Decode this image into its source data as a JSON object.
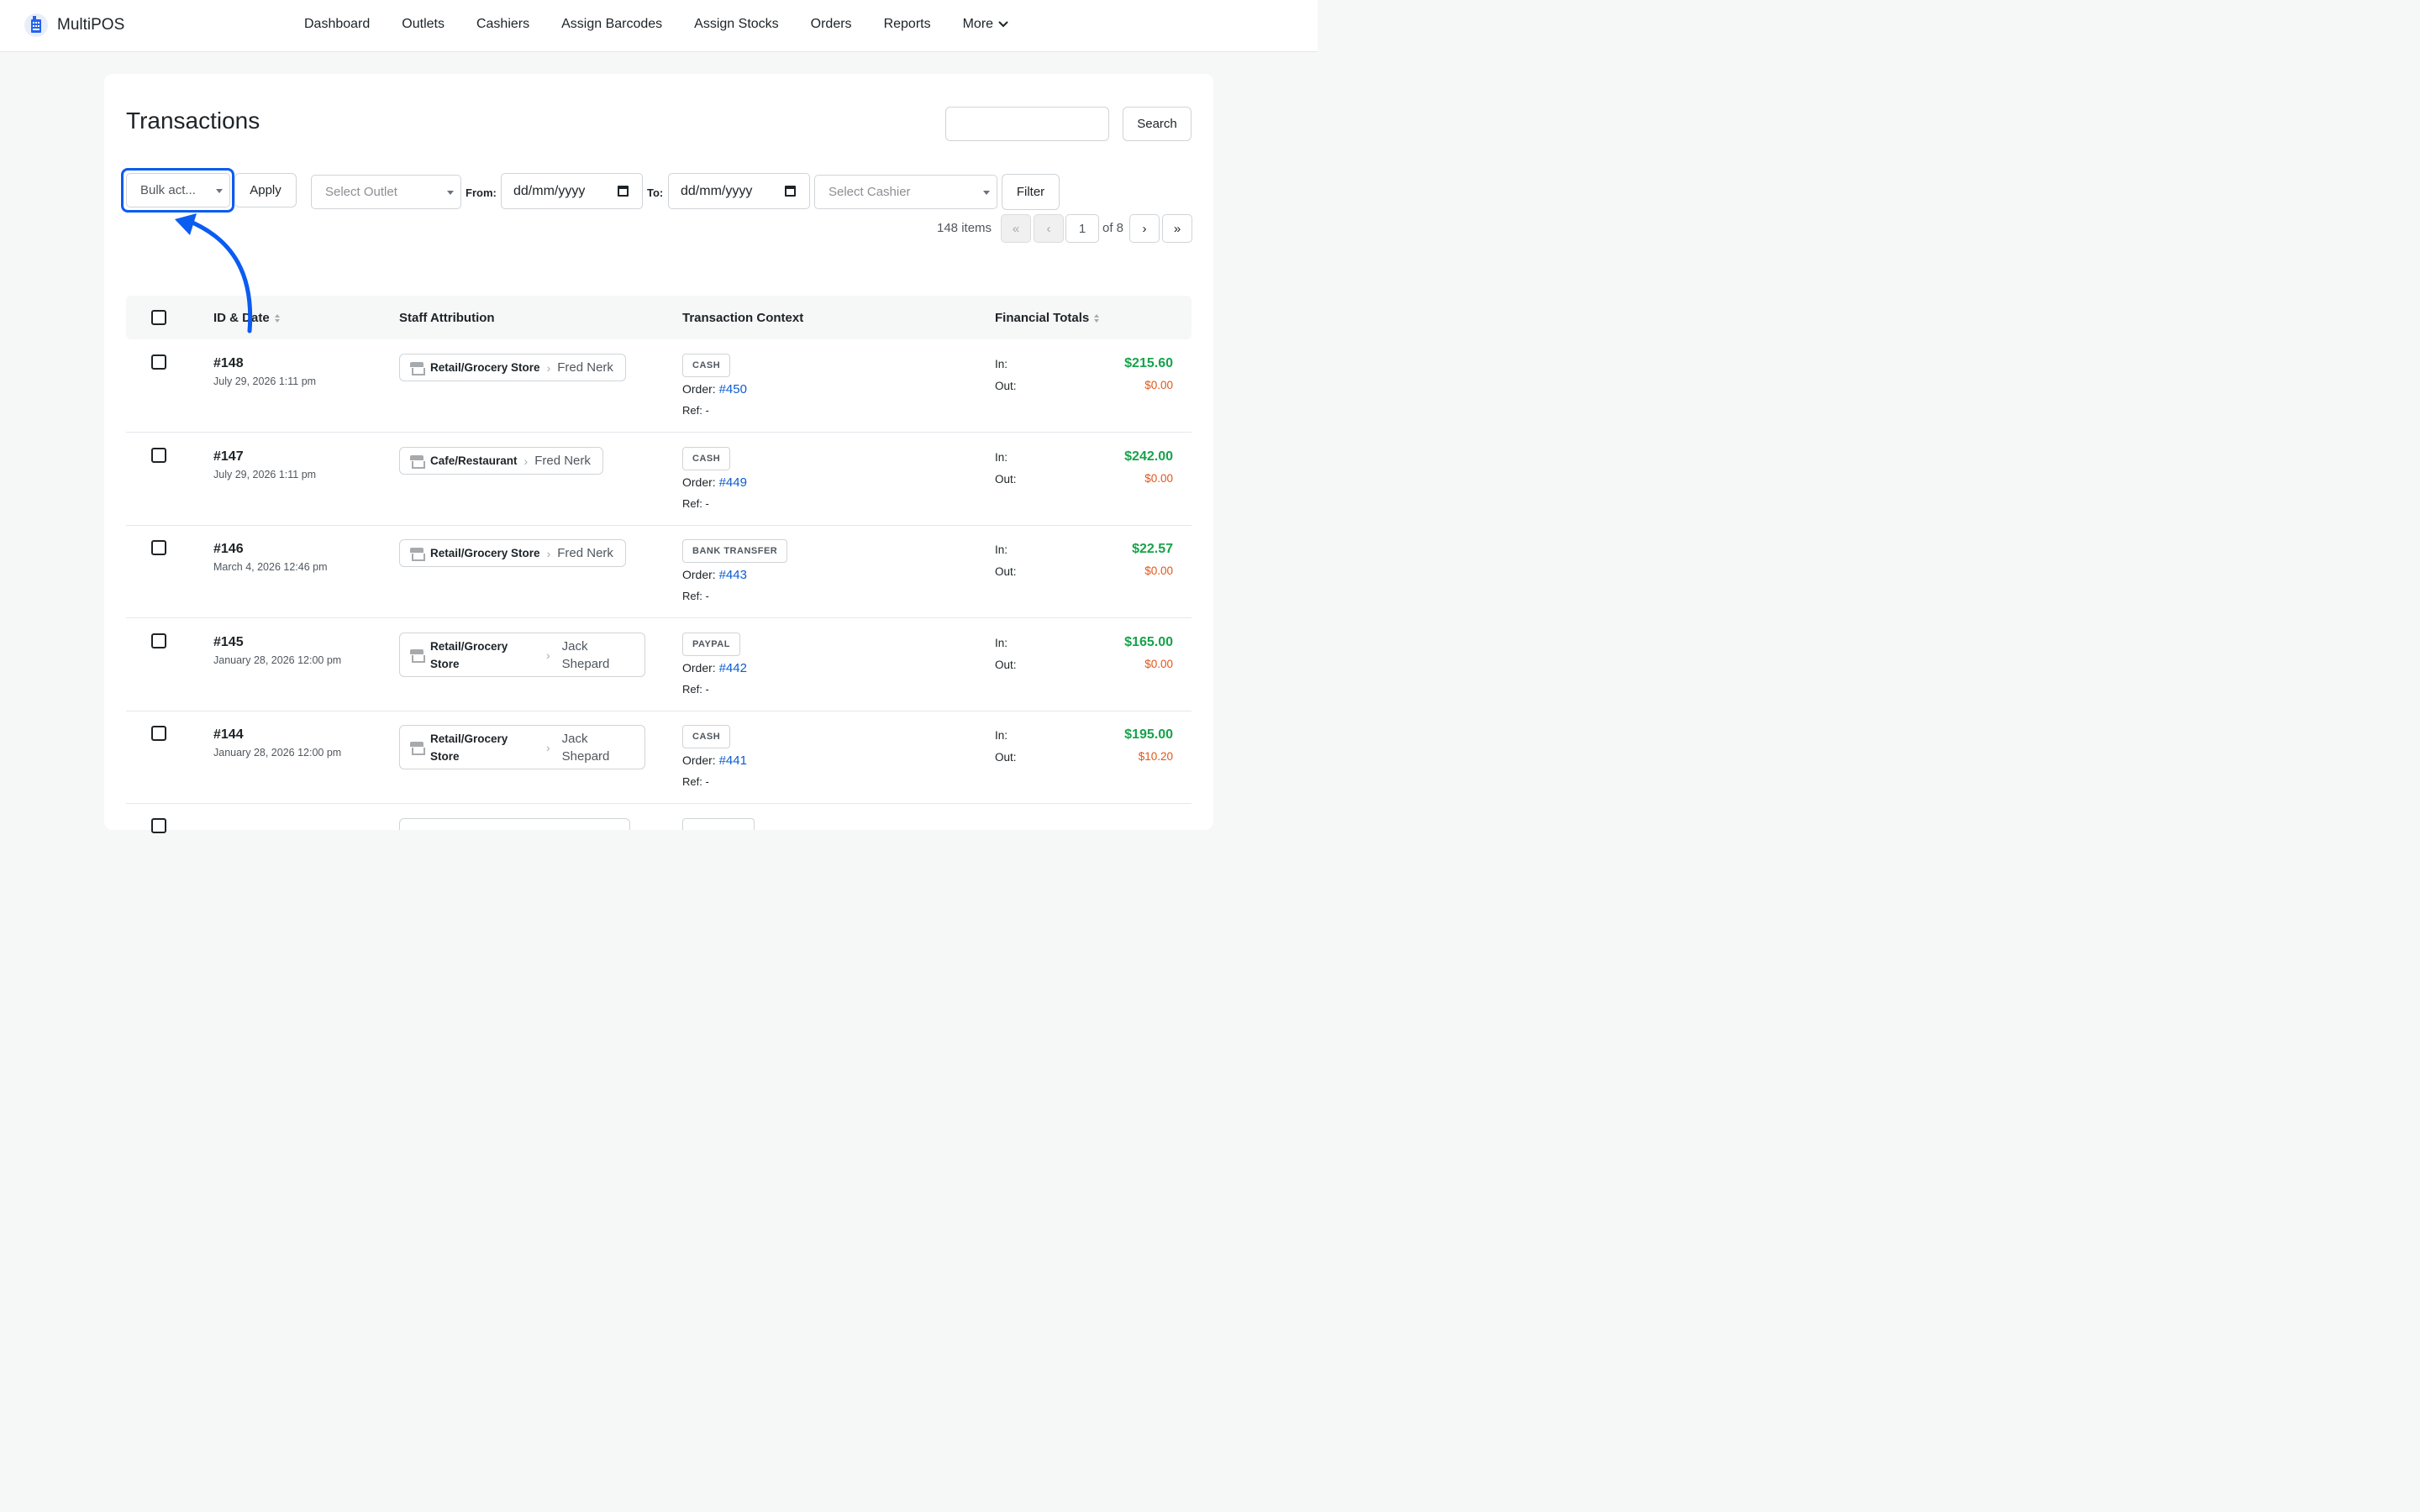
{
  "app": {
    "name": "MultiPOS"
  },
  "nav": {
    "items": [
      "Dashboard",
      "Outlets",
      "Cashiers",
      "Assign Barcodes",
      "Assign Stocks",
      "Orders",
      "Reports"
    ],
    "more_label": "More"
  },
  "page": {
    "title": "Transactions"
  },
  "search": {
    "button_label": "Search",
    "value": ""
  },
  "filters": {
    "bulk_action": "Bulk act...",
    "apply_label": "Apply",
    "outlet_placeholder": "Select Outlet",
    "from_label": "From:",
    "from_placeholder": "dd/mm/yyyy",
    "to_label": "To:",
    "to_placeholder": "dd/mm/yyyy",
    "cashier_placeholder": "Select Cashier",
    "filter_label": "Filter"
  },
  "pagination": {
    "items_count": "148 items",
    "first": "«",
    "prev": "‹",
    "current": "1",
    "of_total": "of 8",
    "next": "›",
    "last": "»"
  },
  "table": {
    "columns": [
      "ID & Date",
      "Staff Attribution",
      "Transaction Context",
      "Financial Totals"
    ],
    "rows": [
      {
        "id": "#148",
        "date": "July 29, 2026 1:11 pm",
        "outlet": "Retail/Grocery Store",
        "cashier": "Fred Nerk",
        "method": "CASH",
        "order_label": "Order:",
        "order": "#450",
        "ref": "Ref: -",
        "in_label": "In:",
        "in": "$215.60",
        "out_label": "Out:",
        "out": "$0.00"
      },
      {
        "id": "#147",
        "date": "July 29, 2026 1:11 pm",
        "outlet": "Cafe/Restaurant",
        "cashier": "Fred Nerk",
        "method": "CASH",
        "order_label": "Order:",
        "order": "#449",
        "ref": "Ref: -",
        "in_label": "In:",
        "in": "$242.00",
        "out_label": "Out:",
        "out": "$0.00"
      },
      {
        "id": "#146",
        "date": "March 4, 2026 12:46 pm",
        "outlet": "Retail/Grocery Store",
        "cashier": "Fred Nerk",
        "method": "BANK TRANSFER",
        "order_label": "Order:",
        "order": "#443",
        "ref": "Ref: -",
        "in_label": "In:",
        "in": "$22.57",
        "out_label": "Out:",
        "out": "$0.00"
      },
      {
        "id": "#145",
        "date": "January 28, 2026 12:00 pm",
        "outlet": "Retail/Grocery Store",
        "cashier": "Jack Shepard",
        "method": "PAYPAL",
        "order_label": "Order:",
        "order": "#442",
        "ref": "Ref: -",
        "in_label": "In:",
        "in": "$165.00",
        "out_label": "Out:",
        "out": "$0.00"
      },
      {
        "id": "#144",
        "date": "January 28, 2026 12:00 pm",
        "outlet": "Retail/Grocery Store",
        "cashier": "Jack Shepard",
        "method": "CASH",
        "order_label": "Order:",
        "order": "#441",
        "ref": "Ref: -",
        "in_label": "In:",
        "in": "$195.00",
        "out_label": "Out:",
        "out": "$10.20"
      }
    ]
  },
  "colors": {
    "accent": "#0b5cf0",
    "in_amount": "#16a34a",
    "out_amount": "#e0561a",
    "link": "#0b5cd0"
  }
}
